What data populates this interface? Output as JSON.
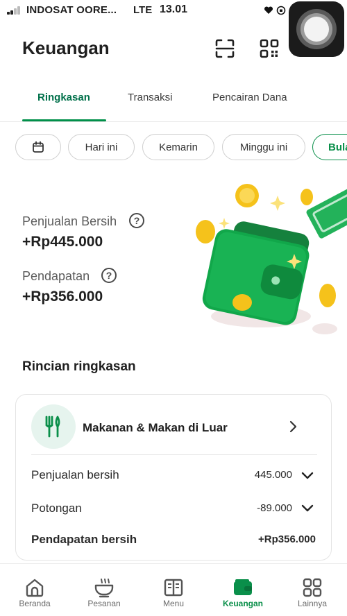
{
  "status_bar": {
    "carrier": "INDOSAT OORE...",
    "network": "LTE",
    "time": "13.01"
  },
  "header": {
    "title": "Keuangan",
    "icons": [
      "scan-icon",
      "qr-code-icon"
    ]
  },
  "tabs": [
    {
      "label": "Ringkasan",
      "active": true
    },
    {
      "label": "Transaksi",
      "active": false
    },
    {
      "label": "Pencairan Dana",
      "active": false
    }
  ],
  "date_filters": [
    {
      "icon": "calendar-icon"
    },
    {
      "label": "Hari ini"
    },
    {
      "label": "Kemarin"
    },
    {
      "label": "Minggu ini"
    },
    {
      "label": "Bula",
      "active": true
    }
  ],
  "summary": {
    "net_sales_label": "Penjualan Bersih",
    "net_sales_value": "+Rp445.000",
    "income_label": "Pendapatan",
    "income_value": "+Rp356.000"
  },
  "details": {
    "title": "Rincian ringkasan",
    "category": {
      "name": "Makanan & Makan di Luar",
      "icon": "fork-knife-icon"
    },
    "rows": [
      {
        "label": "Penjualan bersih",
        "value": "445.000"
      },
      {
        "label": "Potongan",
        "value": "-89.000"
      },
      {
        "label": "Pendapatan bersih",
        "value": "+Rp356.000"
      }
    ]
  },
  "bottom_nav": [
    {
      "label": "Beranda",
      "icon": "home-icon"
    },
    {
      "label": "Pesanan",
      "icon": "bowl-icon"
    },
    {
      "label": "Menu",
      "icon": "menu-book-icon"
    },
    {
      "label": "Keuangan",
      "icon": "wallet-icon",
      "active": true
    },
    {
      "label": "Lainnya",
      "icon": "grid-icon"
    }
  ],
  "colors": {
    "accent": "#0a8f4a",
    "accent_light": "#e6f4ee",
    "text": "#1f1f1f",
    "muted": "#5c5c5c"
  }
}
